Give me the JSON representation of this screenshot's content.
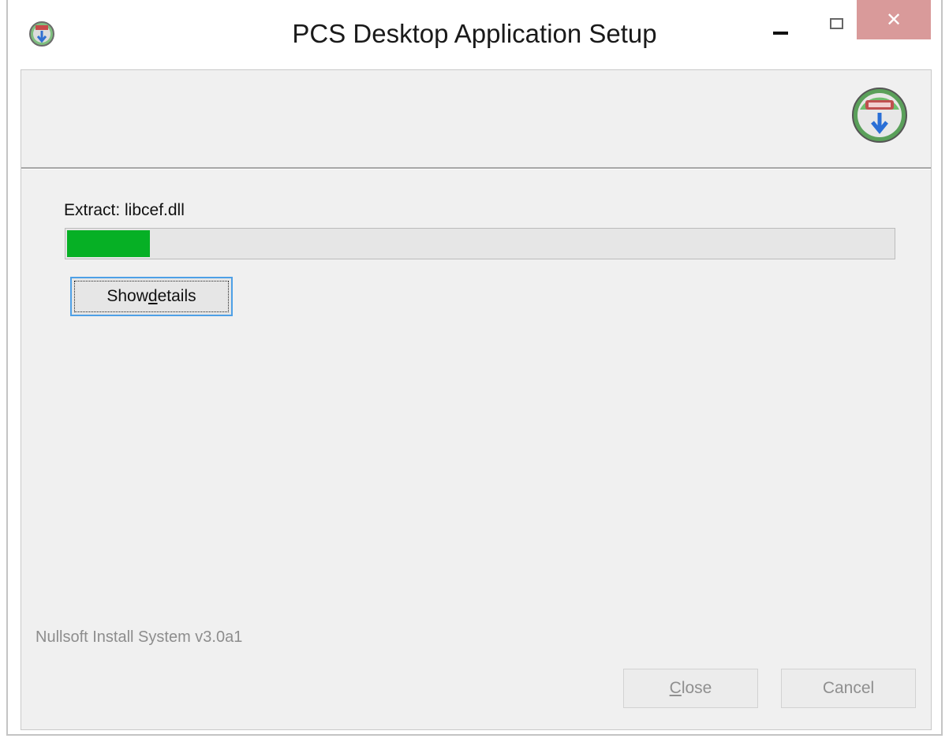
{
  "window": {
    "title": "PCS Desktop Application Setup",
    "controls": {
      "minimize_icon": "minimize-icon",
      "maximize_icon": "maximize-icon",
      "close_glyph": "✕",
      "close_color": "#d99a9a"
    }
  },
  "header": {
    "logo_icon": "nsis-installer-logo-icon"
  },
  "progress": {
    "status": "Extract: libcef.dll",
    "percent": 10,
    "fill_color": "#06b025"
  },
  "show_details": {
    "label_prefix": "Show ",
    "label_accel": "d",
    "label_suffix": "etails"
  },
  "footer": {
    "branding": "Nullsoft Install System v3.0a1",
    "close_accel": "C",
    "close_rest": "lose",
    "cancel_label": "Cancel"
  }
}
